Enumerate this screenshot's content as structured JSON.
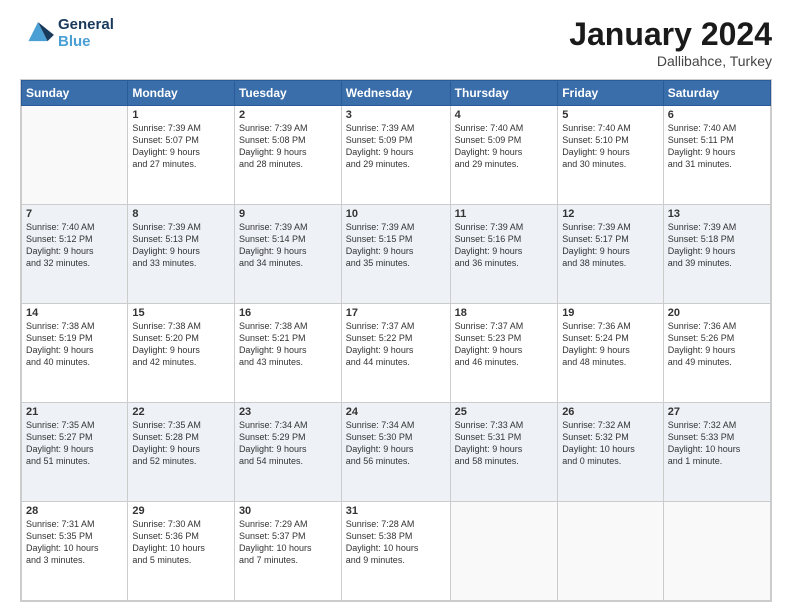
{
  "logo": {
    "line1": "General",
    "line2": "Blue"
  },
  "title": "January 2024",
  "subtitle": "Dallibahce, Turkey",
  "weekdays": [
    "Sunday",
    "Monday",
    "Tuesday",
    "Wednesday",
    "Thursday",
    "Friday",
    "Saturday"
  ],
  "weeks": [
    [
      {
        "day": "",
        "info": ""
      },
      {
        "day": "1",
        "info": "Sunrise: 7:39 AM\nSunset: 5:07 PM\nDaylight: 9 hours\nand 27 minutes."
      },
      {
        "day": "2",
        "info": "Sunrise: 7:39 AM\nSunset: 5:08 PM\nDaylight: 9 hours\nand 28 minutes."
      },
      {
        "day": "3",
        "info": "Sunrise: 7:39 AM\nSunset: 5:09 PM\nDaylight: 9 hours\nand 29 minutes."
      },
      {
        "day": "4",
        "info": "Sunrise: 7:40 AM\nSunset: 5:09 PM\nDaylight: 9 hours\nand 29 minutes."
      },
      {
        "day": "5",
        "info": "Sunrise: 7:40 AM\nSunset: 5:10 PM\nDaylight: 9 hours\nand 30 minutes."
      },
      {
        "day": "6",
        "info": "Sunrise: 7:40 AM\nSunset: 5:11 PM\nDaylight: 9 hours\nand 31 minutes."
      }
    ],
    [
      {
        "day": "7",
        "info": "Sunrise: 7:40 AM\nSunset: 5:12 PM\nDaylight: 9 hours\nand 32 minutes."
      },
      {
        "day": "8",
        "info": "Sunrise: 7:39 AM\nSunset: 5:13 PM\nDaylight: 9 hours\nand 33 minutes."
      },
      {
        "day": "9",
        "info": "Sunrise: 7:39 AM\nSunset: 5:14 PM\nDaylight: 9 hours\nand 34 minutes."
      },
      {
        "day": "10",
        "info": "Sunrise: 7:39 AM\nSunset: 5:15 PM\nDaylight: 9 hours\nand 35 minutes."
      },
      {
        "day": "11",
        "info": "Sunrise: 7:39 AM\nSunset: 5:16 PM\nDaylight: 9 hours\nand 36 minutes."
      },
      {
        "day": "12",
        "info": "Sunrise: 7:39 AM\nSunset: 5:17 PM\nDaylight: 9 hours\nand 38 minutes."
      },
      {
        "day": "13",
        "info": "Sunrise: 7:39 AM\nSunset: 5:18 PM\nDaylight: 9 hours\nand 39 minutes."
      }
    ],
    [
      {
        "day": "14",
        "info": "Sunrise: 7:38 AM\nSunset: 5:19 PM\nDaylight: 9 hours\nand 40 minutes."
      },
      {
        "day": "15",
        "info": "Sunrise: 7:38 AM\nSunset: 5:20 PM\nDaylight: 9 hours\nand 42 minutes."
      },
      {
        "day": "16",
        "info": "Sunrise: 7:38 AM\nSunset: 5:21 PM\nDaylight: 9 hours\nand 43 minutes."
      },
      {
        "day": "17",
        "info": "Sunrise: 7:37 AM\nSunset: 5:22 PM\nDaylight: 9 hours\nand 44 minutes."
      },
      {
        "day": "18",
        "info": "Sunrise: 7:37 AM\nSunset: 5:23 PM\nDaylight: 9 hours\nand 46 minutes."
      },
      {
        "day": "19",
        "info": "Sunrise: 7:36 AM\nSunset: 5:24 PM\nDaylight: 9 hours\nand 48 minutes."
      },
      {
        "day": "20",
        "info": "Sunrise: 7:36 AM\nSunset: 5:26 PM\nDaylight: 9 hours\nand 49 minutes."
      }
    ],
    [
      {
        "day": "21",
        "info": "Sunrise: 7:35 AM\nSunset: 5:27 PM\nDaylight: 9 hours\nand 51 minutes."
      },
      {
        "day": "22",
        "info": "Sunrise: 7:35 AM\nSunset: 5:28 PM\nDaylight: 9 hours\nand 52 minutes."
      },
      {
        "day": "23",
        "info": "Sunrise: 7:34 AM\nSunset: 5:29 PM\nDaylight: 9 hours\nand 54 minutes."
      },
      {
        "day": "24",
        "info": "Sunrise: 7:34 AM\nSunset: 5:30 PM\nDaylight: 9 hours\nand 56 minutes."
      },
      {
        "day": "25",
        "info": "Sunrise: 7:33 AM\nSunset: 5:31 PM\nDaylight: 9 hours\nand 58 minutes."
      },
      {
        "day": "26",
        "info": "Sunrise: 7:32 AM\nSunset: 5:32 PM\nDaylight: 10 hours\nand 0 minutes."
      },
      {
        "day": "27",
        "info": "Sunrise: 7:32 AM\nSunset: 5:33 PM\nDaylight: 10 hours\nand 1 minute."
      }
    ],
    [
      {
        "day": "28",
        "info": "Sunrise: 7:31 AM\nSunset: 5:35 PM\nDaylight: 10 hours\nand 3 minutes."
      },
      {
        "day": "29",
        "info": "Sunrise: 7:30 AM\nSunset: 5:36 PM\nDaylight: 10 hours\nand 5 minutes."
      },
      {
        "day": "30",
        "info": "Sunrise: 7:29 AM\nSunset: 5:37 PM\nDaylight: 10 hours\nand 7 minutes."
      },
      {
        "day": "31",
        "info": "Sunrise: 7:28 AM\nSunset: 5:38 PM\nDaylight: 10 hours\nand 9 minutes."
      },
      {
        "day": "",
        "info": ""
      },
      {
        "day": "",
        "info": ""
      },
      {
        "day": "",
        "info": ""
      }
    ]
  ]
}
